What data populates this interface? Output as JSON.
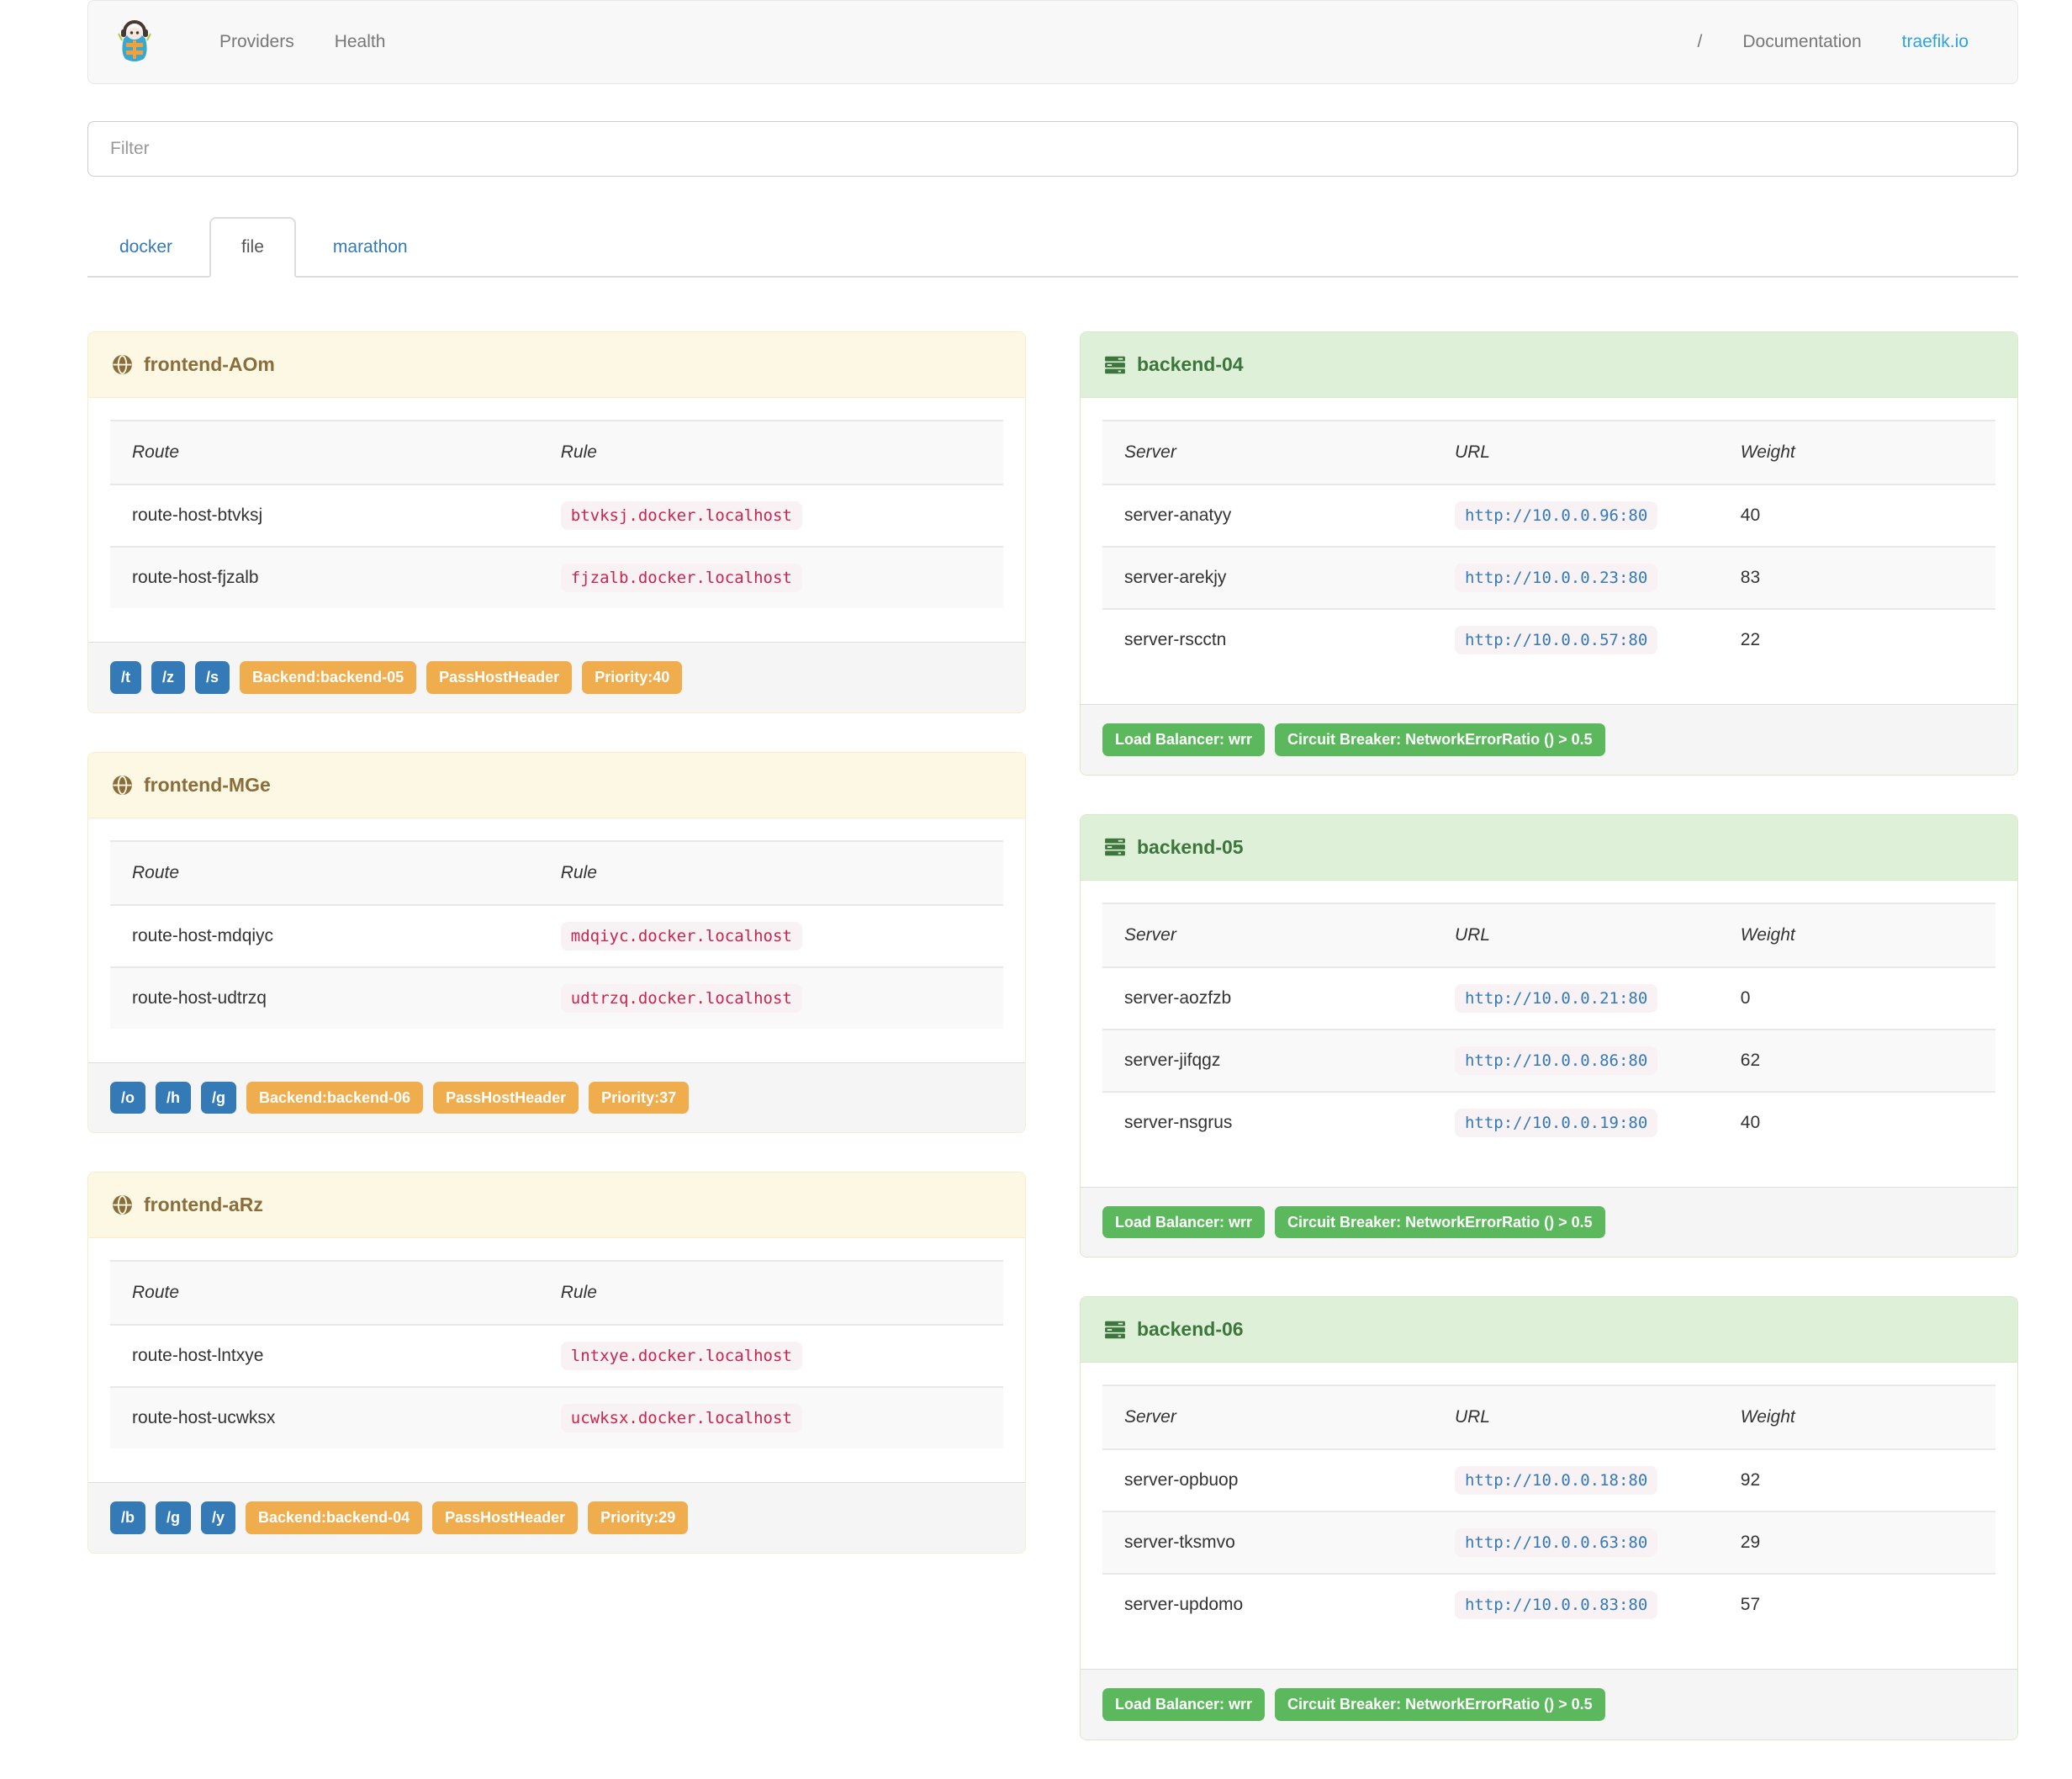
{
  "navbar": {
    "brand_icon": "traefik-logo",
    "links": [
      {
        "label": "Providers"
      },
      {
        "label": "Health"
      }
    ],
    "separator": "/",
    "documentation_label": "Documentation",
    "site_link_label": "traefik.io"
  },
  "filter": {
    "placeholder": "Filter",
    "value": ""
  },
  "tabs": [
    {
      "label": "docker",
      "active": false
    },
    {
      "label": "file",
      "active": true
    },
    {
      "label": "marathon",
      "active": false
    }
  ],
  "labels": {
    "frontend_columns": [
      "Route",
      "Rule"
    ],
    "backend_columns": [
      "Server",
      "URL",
      "Weight"
    ]
  },
  "frontends": [
    {
      "title": "frontend-AOm",
      "routes": [
        {
          "route": "route-host-btvksj",
          "rule": "btvksj.docker.localhost"
        },
        {
          "route": "route-host-fjzalb",
          "rule": "fjzalb.docker.localhost"
        }
      ],
      "entry_tags": [
        "/t",
        "/z",
        "/s"
      ],
      "detail_tags": [
        "Backend:backend-05",
        "PassHostHeader",
        "Priority:40"
      ]
    },
    {
      "title": "frontend-MGe",
      "routes": [
        {
          "route": "route-host-mdqiyc",
          "rule": "mdqiyc.docker.localhost"
        },
        {
          "route": "route-host-udtrzq",
          "rule": "udtrzq.docker.localhost"
        }
      ],
      "entry_tags": [
        "/o",
        "/h",
        "/g"
      ],
      "detail_tags": [
        "Backend:backend-06",
        "PassHostHeader",
        "Priority:37"
      ]
    },
    {
      "title": "frontend-aRz",
      "routes": [
        {
          "route": "route-host-lntxye",
          "rule": "lntxye.docker.localhost"
        },
        {
          "route": "route-host-ucwksx",
          "rule": "ucwksx.docker.localhost"
        }
      ],
      "entry_tags": [
        "/b",
        "/g",
        "/y"
      ],
      "detail_tags": [
        "Backend:backend-04",
        "PassHostHeader",
        "Priority:29"
      ]
    }
  ],
  "backends": [
    {
      "title": "backend-04",
      "servers": [
        {
          "server": "server-anatyy",
          "url": "http://10.0.0.96:80",
          "weight": "40"
        },
        {
          "server": "server-arekjy",
          "url": "http://10.0.0.23:80",
          "weight": "83"
        },
        {
          "server": "server-rscctn",
          "url": "http://10.0.0.57:80",
          "weight": "22"
        }
      ],
      "tags": [
        "Load Balancer: wrr",
        "Circuit Breaker: NetworkErrorRatio () > 0.5"
      ]
    },
    {
      "title": "backend-05",
      "servers": [
        {
          "server": "server-aozfzb",
          "url": "http://10.0.0.21:80",
          "weight": "0"
        },
        {
          "server": "server-jifqgz",
          "url": "http://10.0.0.86:80",
          "weight": "62"
        },
        {
          "server": "server-nsgrus",
          "url": "http://10.0.0.19:80",
          "weight": "40"
        }
      ],
      "tags": [
        "Load Balancer: wrr",
        "Circuit Breaker: NetworkErrorRatio () > 0.5"
      ]
    },
    {
      "title": "backend-06",
      "servers": [
        {
          "server": "server-opbuop",
          "url": "http://10.0.0.18:80",
          "weight": "92"
        },
        {
          "server": "server-tksmvo",
          "url": "http://10.0.0.63:80",
          "weight": "29"
        },
        {
          "server": "server-updomo",
          "url": "http://10.0.0.83:80",
          "weight": "57"
        }
      ],
      "tags": [
        "Load Balancer: wrr",
        "Circuit Breaker: NetworkErrorRatio () > 0.5"
      ]
    }
  ],
  "colors": {
    "navbar_bg": "#f8f8f8",
    "navbar_link": "#777777",
    "site_link_blue": "#30a3dc",
    "tab_link_blue": "#337ab7",
    "frontend_heading_bg": "#fcf8e3",
    "frontend_heading_text": "#8a6d3b",
    "backend_heading_bg": "#dff0d8",
    "backend_heading_text": "#3c763d",
    "tag_blue": "#337ab7",
    "tag_orange": "#f0ad4e",
    "tag_green": "#5cb85c",
    "rule_code_text": "#c7254e",
    "url_code_text": "#337ab7",
    "code_bg": "#f9f2f4",
    "footer_bg": "#f5f5f5"
  }
}
